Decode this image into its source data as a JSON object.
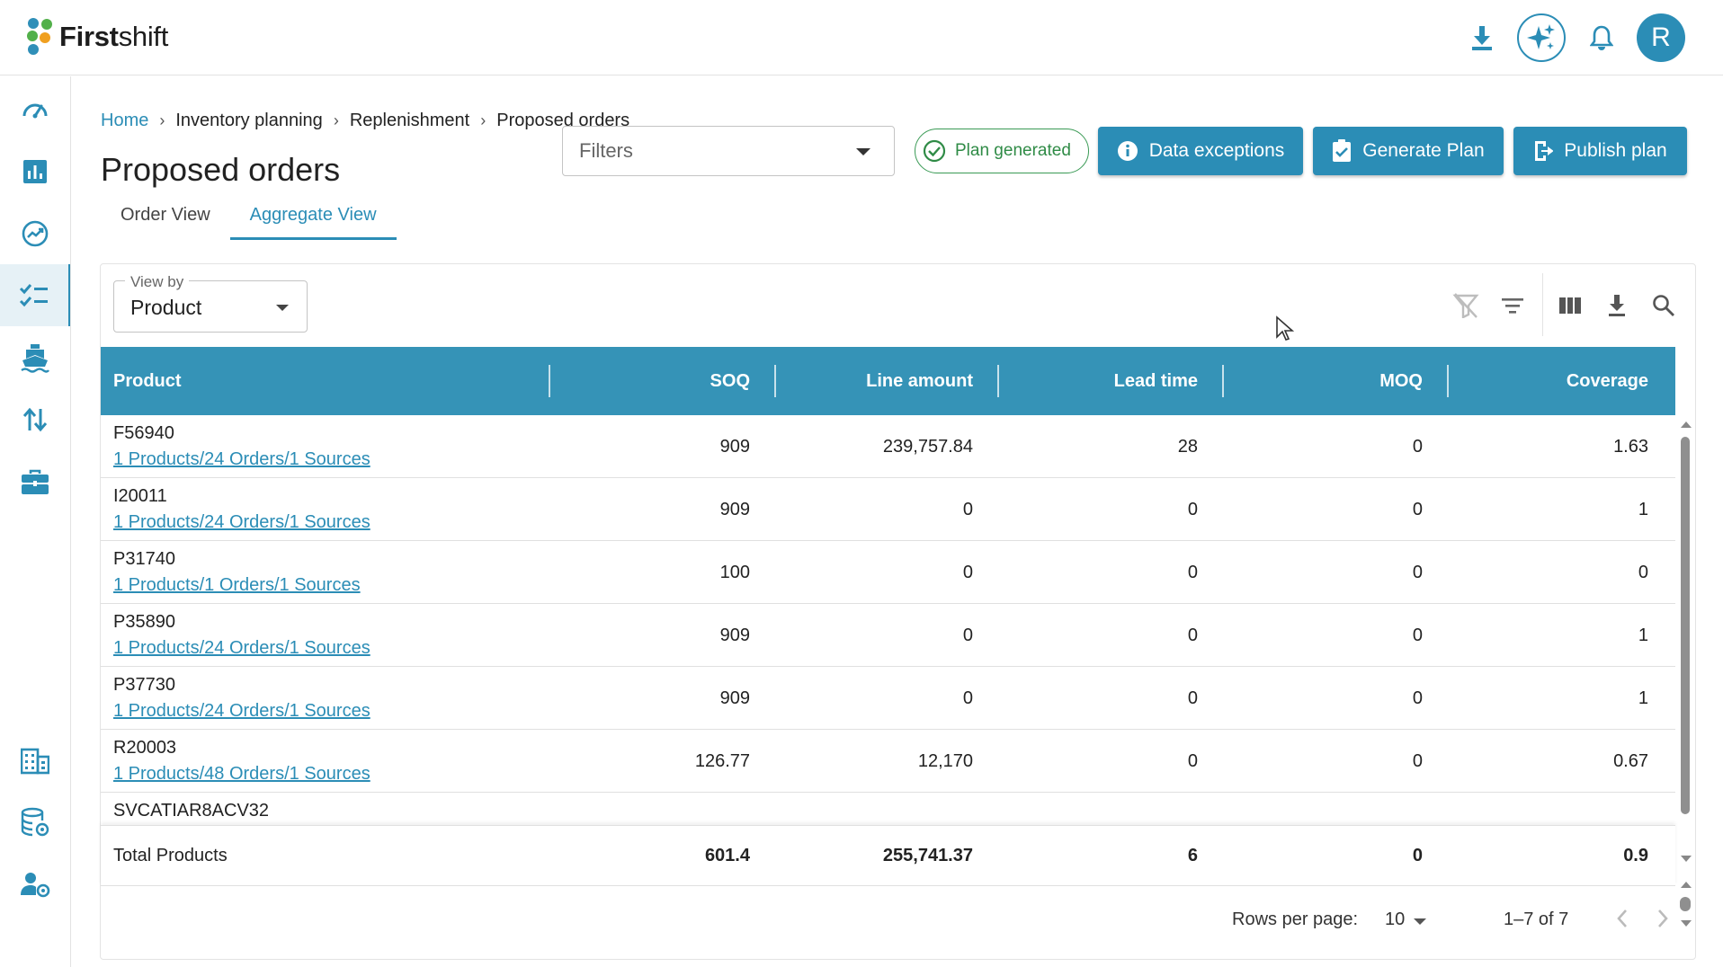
{
  "app": {
    "brand_bold": "First",
    "brand_light": "shift",
    "avatar_letter": "R"
  },
  "colors": {
    "accent": "#2b8db6",
    "header": "#3593b7",
    "success": "#2f8b46"
  },
  "topbar": {
    "icons": [
      "download-icon",
      "ai-sparkle-icon",
      "bell-icon"
    ]
  },
  "sidebar": {
    "items": [
      {
        "icon": "dashboard-gauge-icon",
        "active": false
      },
      {
        "icon": "bar-chart-icon",
        "active": false
      },
      {
        "icon": "trending-icon",
        "active": false
      },
      {
        "icon": "checklist-icon",
        "active": true
      },
      {
        "icon": "ship-icon",
        "active": false
      },
      {
        "icon": "swap-arrows-icon",
        "active": false
      },
      {
        "icon": "briefcase-icon",
        "active": false
      },
      {
        "icon": "building-icon",
        "active": false
      },
      {
        "icon": "database-settings-icon",
        "active": false
      },
      {
        "icon": "user-settings-icon",
        "active": false
      }
    ]
  },
  "breadcrumb": [
    "Home",
    "Inventory planning",
    "Replenishment",
    "Proposed orders"
  ],
  "page_title": "Proposed orders",
  "filters_placeholder": "Filters",
  "plan_status": "Plan generated",
  "buttons": {
    "data_exceptions": "Data exceptions",
    "generate_plan": "Generate Plan",
    "publish_plan": "Publish plan"
  },
  "tabs": [
    {
      "label": "Order View",
      "active": false
    },
    {
      "label": "Aggregate View",
      "active": true
    }
  ],
  "view_by": {
    "label": "View by",
    "value": "Product"
  },
  "table": {
    "columns": [
      "Product",
      "SOQ",
      "Line amount",
      "Lead time",
      "MOQ",
      "Coverage"
    ],
    "rows": [
      {
        "product": "F56940",
        "link": "1 Products/24 Orders/1 Sources",
        "soq": "909",
        "line_amount": "239,757.84",
        "lead_time": "28",
        "moq": "0",
        "coverage": "1.63"
      },
      {
        "product": "I20011",
        "link": "1 Products/24 Orders/1 Sources",
        "soq": "909",
        "line_amount": "0",
        "lead_time": "0",
        "moq": "0",
        "coverage": "1"
      },
      {
        "product": "P31740",
        "link": "1 Products/1 Orders/1 Sources",
        "soq": "100",
        "line_amount": "0",
        "lead_time": "0",
        "moq": "0",
        "coverage": "0"
      },
      {
        "product": "P35890",
        "link": "1 Products/24 Orders/1 Sources",
        "soq": "909",
        "line_amount": "0",
        "lead_time": "0",
        "moq": "0",
        "coverage": "1"
      },
      {
        "product": "P37730",
        "link": "1 Products/24 Orders/1 Sources",
        "soq": "909",
        "line_amount": "0",
        "lead_time": "0",
        "moq": "0",
        "coverage": "1"
      },
      {
        "product": "R20003",
        "link": "1 Products/48 Orders/1 Sources",
        "soq": "126.77",
        "line_amount": "12,170",
        "lead_time": "0",
        "moq": "0",
        "coverage": "0.67"
      }
    ],
    "partial_row_product": "SVCATIAR8ACV32",
    "total": {
      "label": "Total Products",
      "soq": "601.4",
      "line_amount": "255,741.37",
      "lead_time": "6",
      "moq": "0",
      "coverage": "0.9"
    }
  },
  "pagination": {
    "rows_per_page_label": "Rows per page:",
    "rows_per_page": "10",
    "range": "1–7 of 7"
  }
}
